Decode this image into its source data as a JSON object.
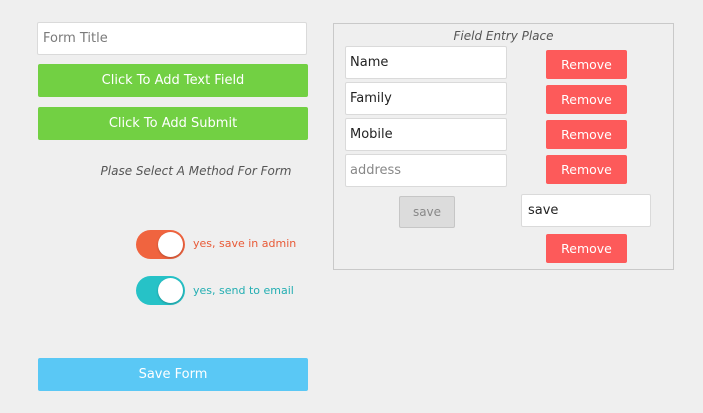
{
  "form": {
    "title_placeholder": "Form Title",
    "add_text_field_label": "Click To Add Text Field",
    "add_submit_label": "Click To Add Submit",
    "method_prompt": "Plase Select A Method For Form",
    "toggles": [
      {
        "label": "yes, save in admin",
        "on": true,
        "color": "#f0643f"
      },
      {
        "label": "yes, send to email",
        "on": true,
        "color": "#26c2c7"
      }
    ],
    "save_form_label": "Save Form"
  },
  "panel": {
    "title": "Field Entry Place",
    "fields": [
      {
        "value": "Name",
        "placeholder": "",
        "remove_label": "Remove"
      },
      {
        "value": "Family",
        "placeholder": "",
        "remove_label": "Remove"
      },
      {
        "value": "Mobile",
        "placeholder": "",
        "remove_label": "Remove"
      },
      {
        "value": "",
        "placeholder": "address",
        "remove_label": "Remove"
      }
    ],
    "submit": {
      "button_label": "save",
      "input_value": "save",
      "remove_label": "Remove"
    }
  },
  "colors": {
    "green": "#72d043",
    "red": "#fd5a5a",
    "blue": "#5ac8f5",
    "background": "#efefef"
  }
}
